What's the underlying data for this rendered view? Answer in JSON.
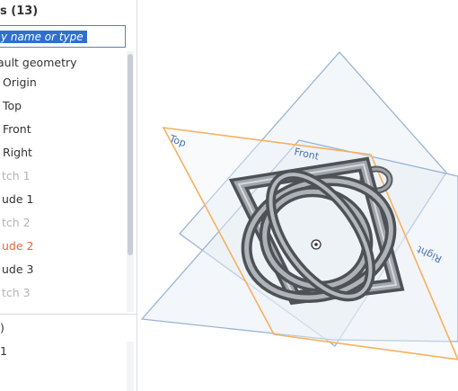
{
  "feature_panel": {
    "header": "s (13)",
    "search_placeholder": "y name or type",
    "items": [
      {
        "label": "ault geometry",
        "state": "normal"
      },
      {
        "label": "Origin",
        "state": "normal"
      },
      {
        "label": "Top",
        "state": "normal"
      },
      {
        "label": "Front",
        "state": "normal"
      },
      {
        "label": "Right",
        "state": "normal"
      },
      {
        "label": "tch 1",
        "state": "suppressed"
      },
      {
        "label": "ude 1",
        "state": "normal"
      },
      {
        "label": "tch 2",
        "state": "suppressed"
      },
      {
        "label": "ude 2",
        "state": "error"
      },
      {
        "label": "ude 3",
        "state": "normal"
      },
      {
        "label": "tch 3",
        "state": "suppressed"
      }
    ],
    "lower_section": {
      "header": ")",
      "item": "1"
    }
  },
  "viewport": {
    "planes": {
      "top": "Top",
      "front": "Front",
      "right": "Right"
    },
    "colors": {
      "plane_edge": "#9ab4d4",
      "selected_plane": "#f6b15d",
      "plane_label": "#4a72b0"
    }
  }
}
